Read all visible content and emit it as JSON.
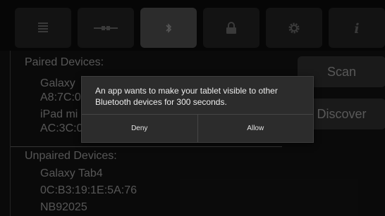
{
  "toolbar": {
    "tabs": [
      {
        "icon": "list-icon",
        "active": false
      },
      {
        "icon": "connection-icon",
        "active": false
      },
      {
        "icon": "bluetooth-icon",
        "active": true
      },
      {
        "icon": "lock-icon",
        "active": false
      },
      {
        "icon": "gear-icon",
        "active": false
      },
      {
        "icon": "info-icon",
        "active": false
      }
    ]
  },
  "paired": {
    "header": "Paired Devices:",
    "devices": [
      {
        "name": "Galaxy",
        "address": "A8:7C:0"
      },
      {
        "name": "iPad mi",
        "address": "AC:3C:0"
      }
    ]
  },
  "unpaired": {
    "header": "Unpaired Devices:",
    "devices": [
      {
        "name": "Galaxy Tab4",
        "address": "0C:B3:19:1E:5A:76"
      },
      {
        "name": "NB92025",
        "address": ""
      }
    ]
  },
  "actions": {
    "scan_label": "Scan",
    "discover_label": "Discover"
  },
  "dialog": {
    "message": "An app wants to make your tablet visible to other Bluetooth devices for 300 seconds.",
    "deny_label": "Deny",
    "allow_label": "Allow"
  },
  "colors": {
    "background": "#111111",
    "active_tab": "#474747",
    "inactive_tab": "#1f1f1f",
    "dialog": "#2c2c2c",
    "text_dim": "#8c8c8c"
  }
}
